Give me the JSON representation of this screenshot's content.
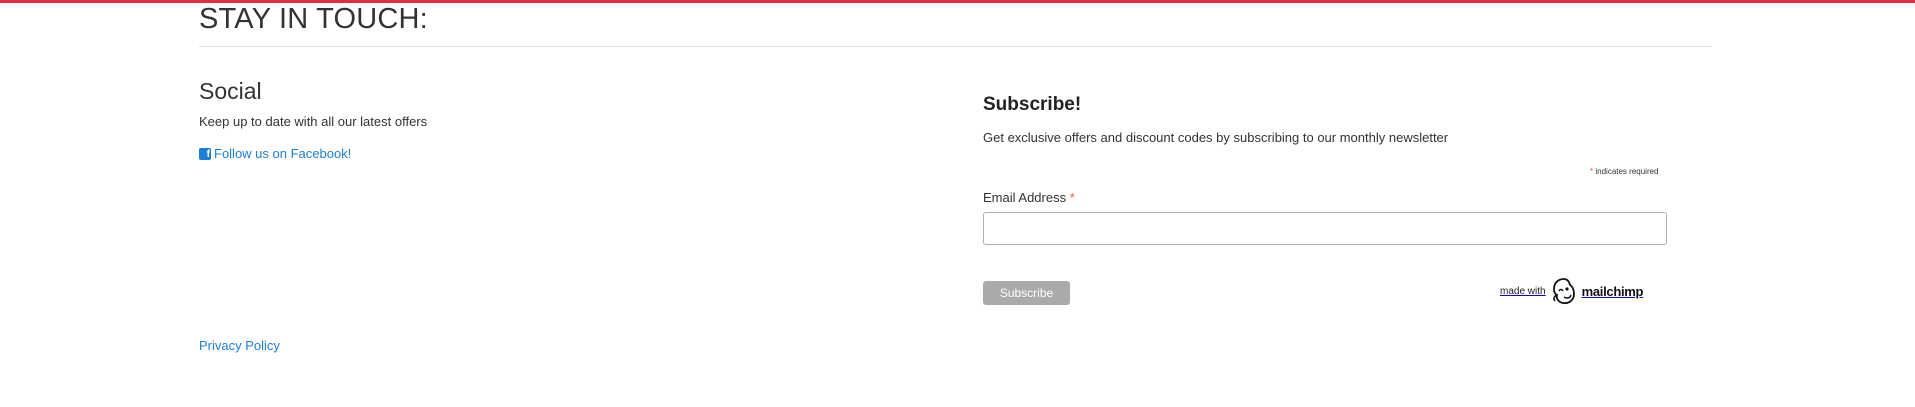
{
  "section": {
    "title": "STAY IN TOUCH:"
  },
  "social": {
    "heading": "Social",
    "description": "Keep up to date with all our latest offers",
    "facebook_link": "Follow us on Facebook!"
  },
  "footer": {
    "privacy_link": "Privacy Policy"
  },
  "subscribe": {
    "heading": "Subscribe!",
    "description": "Get exclusive offers and discount codes by subscribing to our monthly newsletter",
    "required_note": "indicates required",
    "required_marker": "*",
    "email_label": "Email Address",
    "email_value": "",
    "button_label": "Subscribe",
    "badge_made_with": "made with",
    "badge_brand": "mailchimp"
  },
  "colors": {
    "accent_bar": "#e32d3f",
    "link": "#1d7fd3",
    "button": "#aaaaaa",
    "required": "#e85c41"
  }
}
